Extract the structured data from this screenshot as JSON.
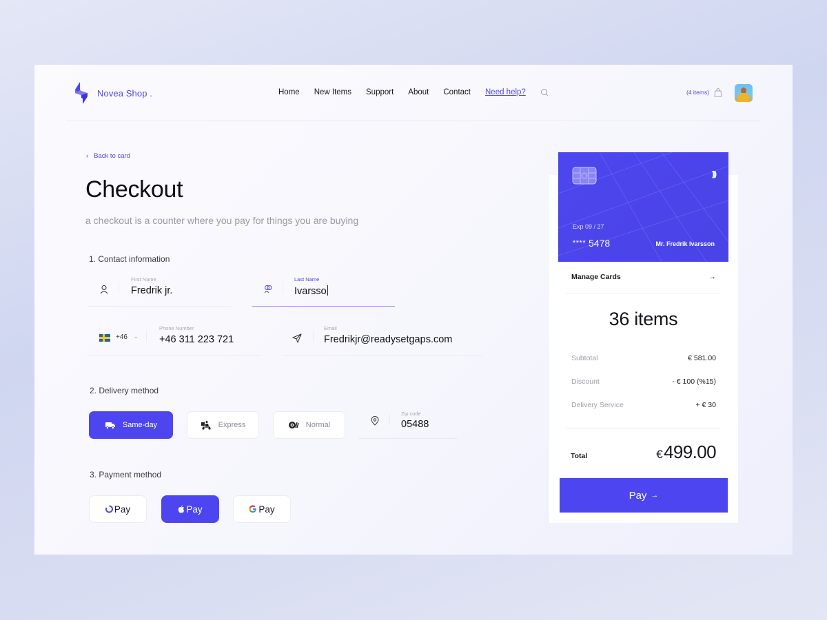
{
  "brand": {
    "name": "Novea Shop .",
    "accent": "#4c45f0"
  },
  "nav": {
    "items": [
      "Home",
      "New Items",
      "Support",
      "About",
      "Contact"
    ],
    "help": "Need help?"
  },
  "cart": {
    "count_label": "(4 items)"
  },
  "page": {
    "back_label": "Back to card",
    "title": "Checkout",
    "subtitle": "a checkout is a counter where you pay for things you are buying"
  },
  "contact": {
    "heading": "1. Contact information",
    "first_name": {
      "label": "First Name",
      "value": "Fredrik jr."
    },
    "last_name": {
      "label": "Last Name",
      "value": "Ivarsso"
    },
    "phone": {
      "country_code": "+46",
      "label": "Phone Number",
      "value": "+46 311 223 721"
    },
    "email": {
      "label": "Email",
      "value": "Fredrikjr@readysetgaps.com"
    }
  },
  "delivery": {
    "heading": "2. Delivery method",
    "options": [
      {
        "label": "Same-day",
        "selected": true
      },
      {
        "label": "Express",
        "selected": false
      },
      {
        "label": "Normal",
        "selected": false
      }
    ],
    "zip": {
      "label": "Zip code",
      "value": "05488"
    }
  },
  "payment": {
    "heading": "3. Payment method",
    "options": [
      {
        "label": "Pay",
        "brand": "O Pay",
        "selected": false
      },
      {
        "label": "Pay",
        "brand": "Apple Pay",
        "selected": true
      },
      {
        "label": "Pay",
        "brand": "Google Pay",
        "selected": false
      }
    ]
  },
  "card": {
    "expiry": "Exp  09 / 27",
    "masked": "****",
    "last4": "5478",
    "holder": "Mr. Fredrik Ivarsson"
  },
  "summary": {
    "manage_cards": "Manage Cards",
    "manage_arrow": "→",
    "items": "36 items",
    "subtotal": {
      "label": "Subtotal",
      "value": "€ 581.00"
    },
    "discount": {
      "label": "Discount",
      "value": "- € 100 (%15)"
    },
    "delivery": {
      "label": "Delivery Service",
      "value": "+ € 30"
    },
    "total": {
      "label": "Total",
      "currency": "€",
      "value": "499.00"
    },
    "pay_button": "Pay",
    "pay_arrow": "→"
  }
}
